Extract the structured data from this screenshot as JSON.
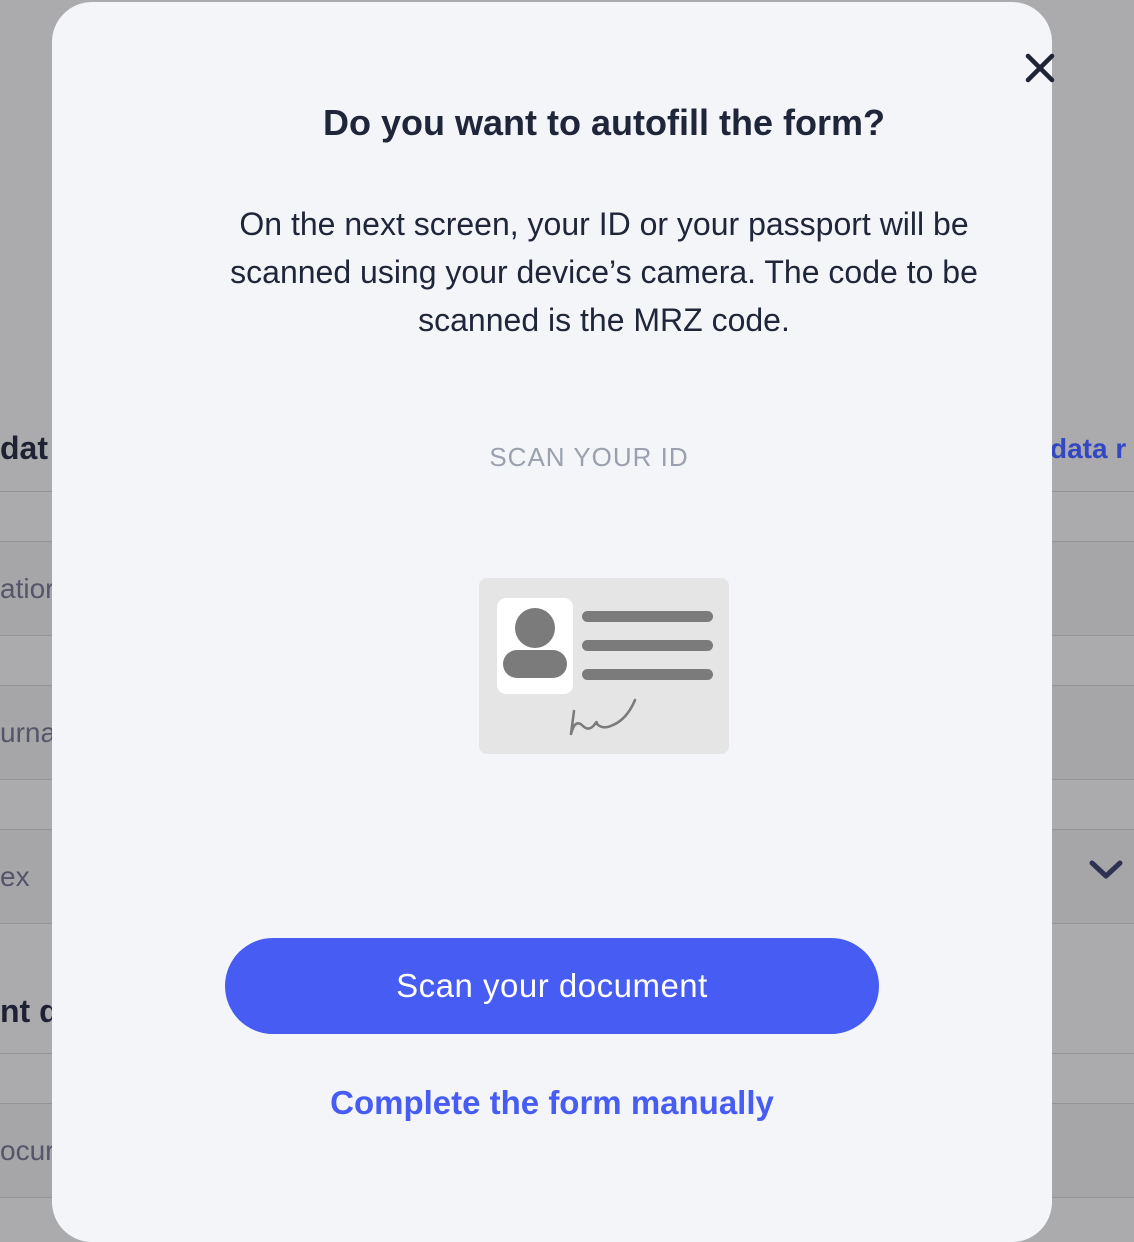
{
  "background_page": {
    "section_title_left": "dat",
    "section_link_right": "data r",
    "field_1_fragment": "atior",
    "field_2_fragment": "urna",
    "field_3_fragment": "ex",
    "section_2_title_left": "nt d",
    "field_4_fragment": "ocur"
  },
  "modal": {
    "title": "Do you want to autofill the form?",
    "description": "On the next screen, your ID or your passport will be scanned using your device’s camera. The code to be scanned is the MRZ code.",
    "scan_label": "SCAN YOUR  ID",
    "primary_button": "Scan your document",
    "secondary_link": "Complete the form manually",
    "close_icon": "close-icon",
    "illustration_icon": "id-card-icon"
  },
  "colors": {
    "accent": "#465cf2",
    "title_text": "#20263a",
    "modal_background": "#f3f5f9",
    "overlay": "#ababad"
  }
}
